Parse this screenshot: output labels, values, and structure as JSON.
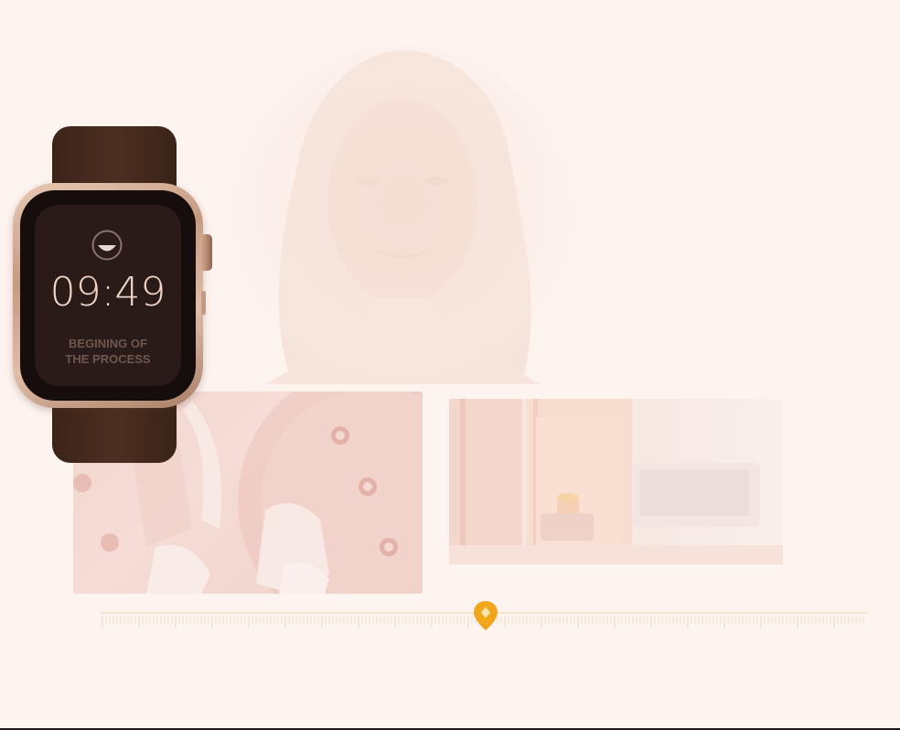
{
  "watch": {
    "time": "09:49",
    "caption": "BEGINING OF\nTHE PROCESS",
    "face_icon": "smile-face-icon"
  },
  "timeline": {
    "marker_icon": "location-pin-icon",
    "marker_position_fraction": 0.5
  },
  "colors": {
    "background": "#fdf3ef",
    "strap": "#4d2f21",
    "case": "#c59a80",
    "screen": "#2a1a18",
    "time_text": "#f1d6c8",
    "caption_text": "#6f5750",
    "marker": "#f2a71b",
    "timeline_line": "#f1d9b5"
  }
}
